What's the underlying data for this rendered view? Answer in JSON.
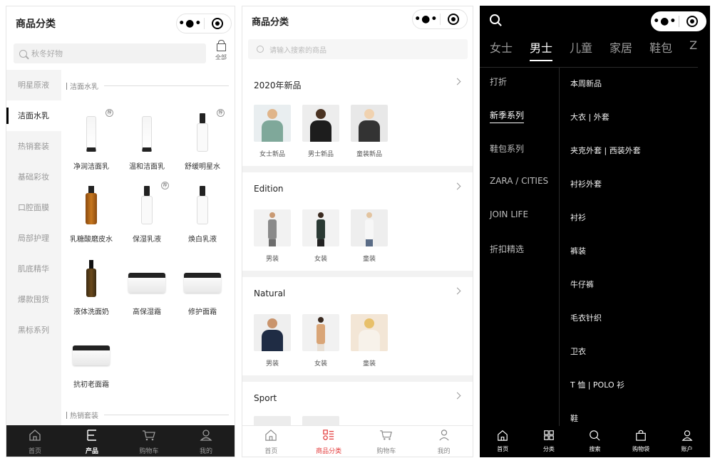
{
  "screen1": {
    "title": "商品分类",
    "search_placeholder": "秋冬好物",
    "all_label": "全部",
    "sidebar": [
      "明星原液",
      "洁面水乳",
      "热销套装",
      "基础彩妆",
      "口腔面膜",
      "局部护理",
      "肌底精华",
      "爆款囤货",
      "黑标系列"
    ],
    "active_index": 1,
    "section1": "洁面水乳",
    "section2": "热销套装",
    "products": [
      {
        "name": "净润洁面乳",
        "tag": "荐"
      },
      {
        "name": "温和洁面乳",
        "tag": ""
      },
      {
        "name": "舒缓明星水",
        "tag": "荐"
      },
      {
        "name": "乳糖酸磨皮水",
        "tag": ""
      },
      {
        "name": "保湿乳液",
        "tag": "荐"
      },
      {
        "name": "焕白乳液",
        "tag": ""
      },
      {
        "name": "液体洗面奶",
        "tag": ""
      },
      {
        "name": "高保湿霜",
        "tag": ""
      },
      {
        "name": "修护面霜",
        "tag": ""
      },
      {
        "name": "抗初老面霜",
        "tag": ""
      }
    ],
    "tabbar": [
      "首页",
      "产品",
      "购物车",
      "我的"
    ]
  },
  "screen2": {
    "title": "商品分类",
    "search_placeholder": "请输入搜索的商品",
    "cards": [
      {
        "title": "2020年新品",
        "items": [
          "女士新品",
          "男士新品",
          "童装新品"
        ]
      },
      {
        "title": "Edition",
        "items": [
          "男装",
          "女装",
          "童装"
        ]
      },
      {
        "title": "Natural",
        "items": [
          "男装",
          "女装",
          "童装"
        ]
      },
      {
        "title": "Sport",
        "items": []
      }
    ],
    "tabbar": [
      "首页",
      "商品分类",
      "购物车",
      "我的"
    ],
    "accent": "#e33b3b"
  },
  "screen3": {
    "tabs": [
      "女士",
      "男士",
      "儿童",
      "家居",
      "鞋包",
      "Z"
    ],
    "active_tab": 1,
    "left": [
      "打折",
      "新季系列",
      "鞋包系列",
      "ZARA / CITIES",
      "JOIN LIFE",
      "折扣精选"
    ],
    "left_active": 1,
    "right": [
      "本周新品",
      "大衣 | 外套",
      "夹克外套 | 西装外套",
      "衬衫外套",
      "衬衫",
      "裤装",
      "牛仔裤",
      "毛衣针织",
      "卫衣",
      "T 恤 | POLO 衫",
      "鞋"
    ],
    "tabbar": [
      "首页",
      "分类",
      "搜索",
      "购物袋",
      "账户"
    ]
  }
}
